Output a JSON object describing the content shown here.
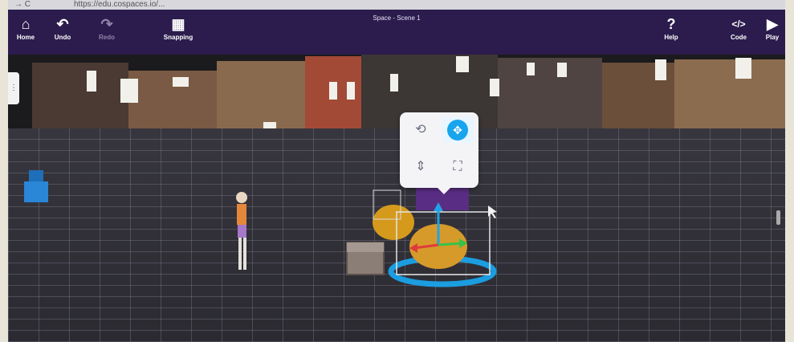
{
  "browser": {
    "nav_glyphs": "→  C",
    "url": "https://edu.cospaces.io/..."
  },
  "toolbar": {
    "home_label": "Home",
    "undo_label": "Undo",
    "redo_label": "Redo",
    "snapping_label": "Snapping",
    "scene_title": "Space - Scene 1",
    "help_label": "Help",
    "code_label": "Code",
    "play_label": "Play"
  },
  "icons": {
    "home": "home-icon",
    "undo": "undo-icon",
    "redo": "redo-icon",
    "snapping": "grid-icon",
    "help": "help-icon",
    "code": "code-icon",
    "play": "play-icon"
  },
  "popup": {
    "tools": [
      "rotate-icon",
      "move-icon",
      "lift-icon",
      "scale-icon"
    ],
    "active_tool": "move-icon"
  },
  "colors": {
    "toolbar_bg": "#2b1c4d",
    "accent": "#19a4ee",
    "floor": "#34333a"
  }
}
